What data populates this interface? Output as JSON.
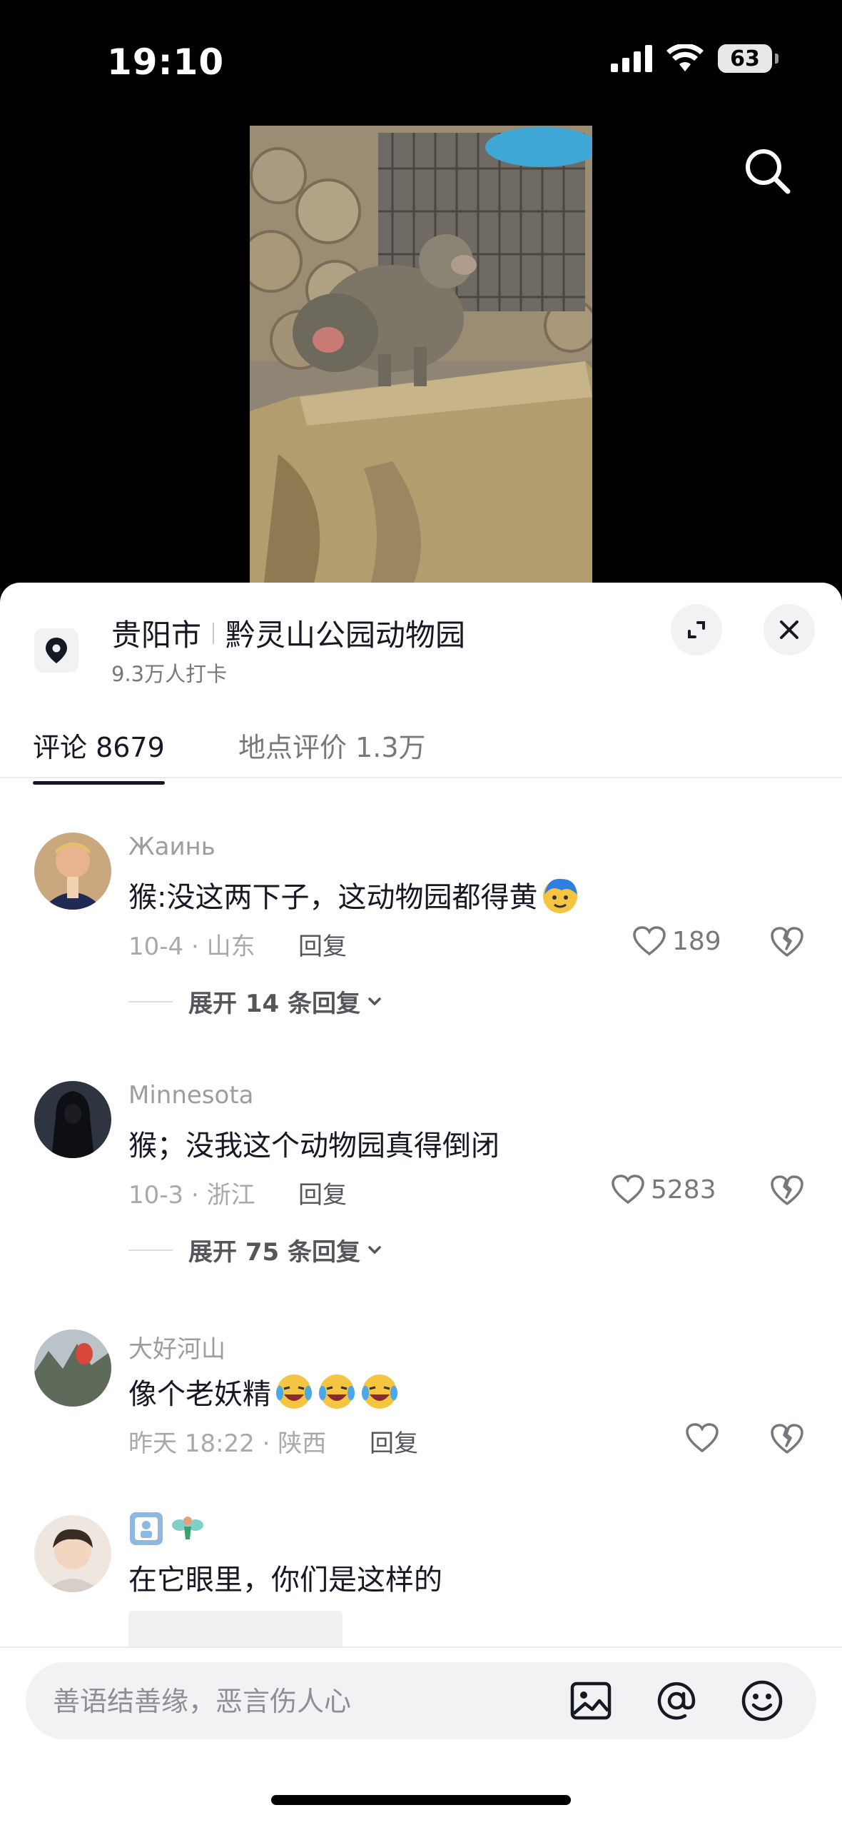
{
  "status": {
    "time": "19:10",
    "battery": "63"
  },
  "location": {
    "city": "贵阳市",
    "place": "黔灵山公园动物园",
    "checkins": "9.3万人打卡"
  },
  "tabs": [
    {
      "label": "评论 8679"
    },
    {
      "label": "地点评价 1.3万"
    }
  ],
  "comments": [
    {
      "user": "Жаинь",
      "text": "猴:没这两下子，这动物园都得黄",
      "emoji": "face-emoji",
      "meta": "10-4 · 山东",
      "reply": "回复",
      "likes": "189",
      "expand": "展开 14 条回复"
    },
    {
      "user": "Minnesota",
      "text": "猴；没我这个动物园真得倒闭",
      "meta": "10-3 · 浙江",
      "reply": "回复",
      "likes": "5283",
      "expand": "展开 75 条回复"
    },
    {
      "user": "大好河山",
      "text": "像个老妖精",
      "emoji": "laughing-crying-emoji x3",
      "meta": "昨天 18:22 · 陕西",
      "reply": "回复",
      "likes": ""
    },
    {
      "user": "",
      "text": "在它眼里，你们是这样的"
    }
  ],
  "input": {
    "placeholder": "善语结善缘，恶言伤人心"
  },
  "icons": {
    "search": "search-icon",
    "location": "location-pin-icon",
    "expand": "expand-icon",
    "close": "close-icon",
    "like": "heart-icon",
    "dislike": "broken-heart-icon",
    "image": "image-icon",
    "mention": "at-icon",
    "emoji": "emoji-icon"
  },
  "colors": {
    "primary_text": "#161823",
    "secondary_text": "#77787d",
    "sheet_bg": "#ffffff",
    "input_bg": "#f2f2f4"
  }
}
